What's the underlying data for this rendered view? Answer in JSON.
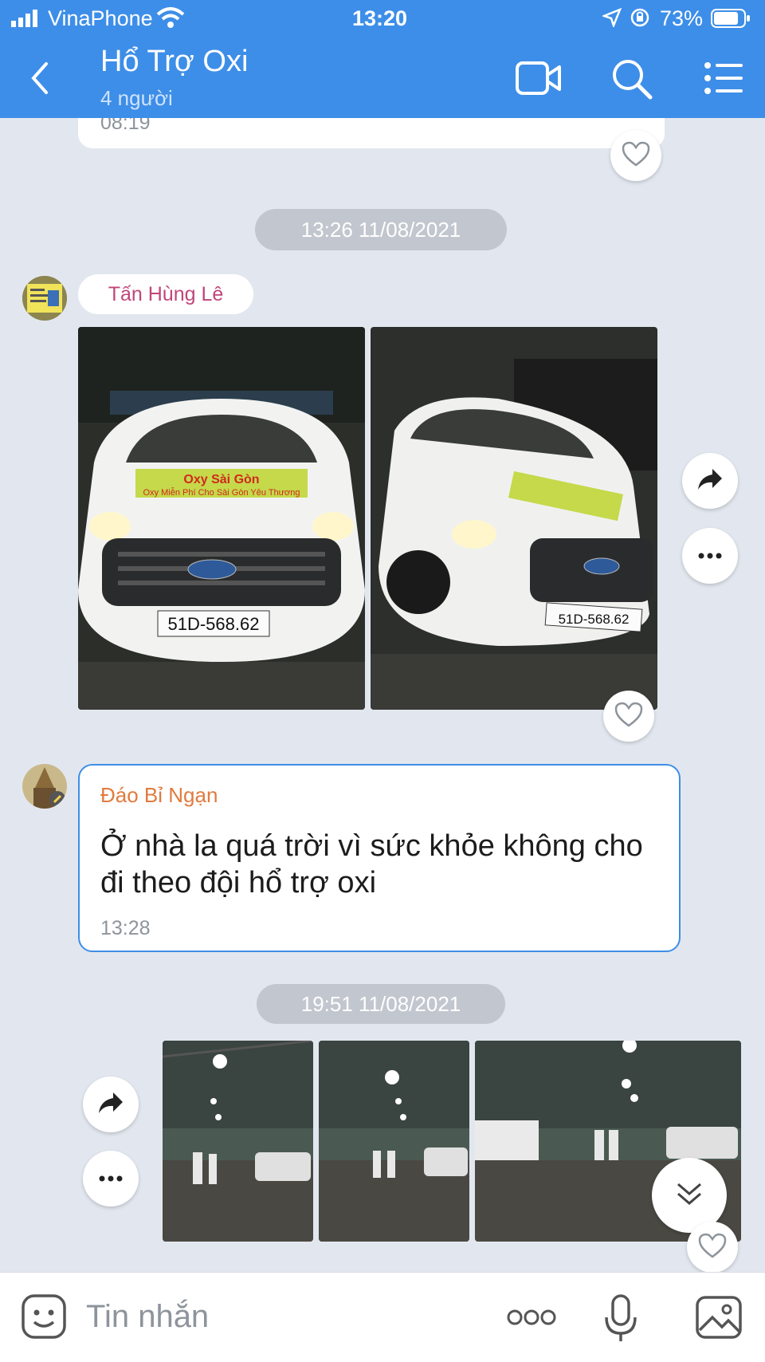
{
  "status_bar": {
    "carrier": "VinaPhone",
    "time": "13:20",
    "battery": "73%"
  },
  "header": {
    "title": "Hổ Trợ Oxi",
    "subtitle": "4 người"
  },
  "messages": {
    "prev_time": "08:19",
    "divider_1": "13:26 11/08/2021",
    "sender_1": "Tấn Hùng Lê",
    "plate_1": "51D-568.62",
    "plate_2": "51D-568.62",
    "banner_1": "Oxy Sài Gòn",
    "banner_2": "Oxy Miễn Phí Cho Sài Gòn Yêu Thương",
    "sender_2": "Đáo Bỉ Ngạn",
    "text_2_line1": "Ở nhà la quá trời vì sức khỏe không cho",
    "text_2_line2": "đi theo đội hổ trợ oxi",
    "time_2": "13:28",
    "divider_2": "19:51 11/08/2021"
  },
  "composer": {
    "placeholder": "Tin nhắn"
  },
  "colors": {
    "header_bg": "#3d8ee8",
    "chat_bg": "#e2e7ef",
    "sender_1": "#c0457a",
    "sender_2": "#e07b3f",
    "bubble_border": "#3d8ee8"
  },
  "icons": [
    "signal-icon",
    "wifi-icon",
    "location-icon",
    "lock-rotation-icon",
    "battery-icon",
    "back-icon",
    "video-call-icon",
    "search-icon",
    "menu-icon",
    "heart-icon",
    "share-icon",
    "more-icon",
    "scroll-down-icon",
    "emoji-icon",
    "more-dots-icon",
    "microphone-icon",
    "gallery-icon"
  ]
}
